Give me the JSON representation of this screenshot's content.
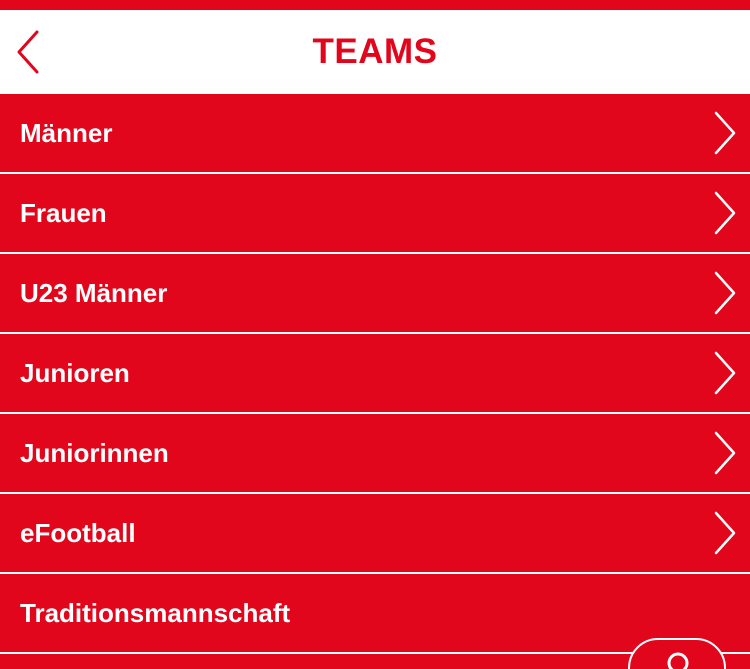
{
  "header": {
    "title": "TEAMS",
    "back_icon": "chevron-left-icon"
  },
  "teams": {
    "items": [
      {
        "label": "Männer",
        "has_chevron": true
      },
      {
        "label": "Frauen",
        "has_chevron": true
      },
      {
        "label": "U23 Männer",
        "has_chevron": true
      },
      {
        "label": "Junioren",
        "has_chevron": true
      },
      {
        "label": "Juniorinnen",
        "has_chevron": true
      },
      {
        "label": "eFootball",
        "has_chevron": true
      },
      {
        "label": "Traditionsmannschaft",
        "has_chevron": false
      }
    ]
  },
  "fab": {
    "icon": "search-icon"
  },
  "colors": {
    "brand_red": "#e2061c",
    "header_bg": "#ffffff",
    "text_on_red": "#ffffff"
  }
}
